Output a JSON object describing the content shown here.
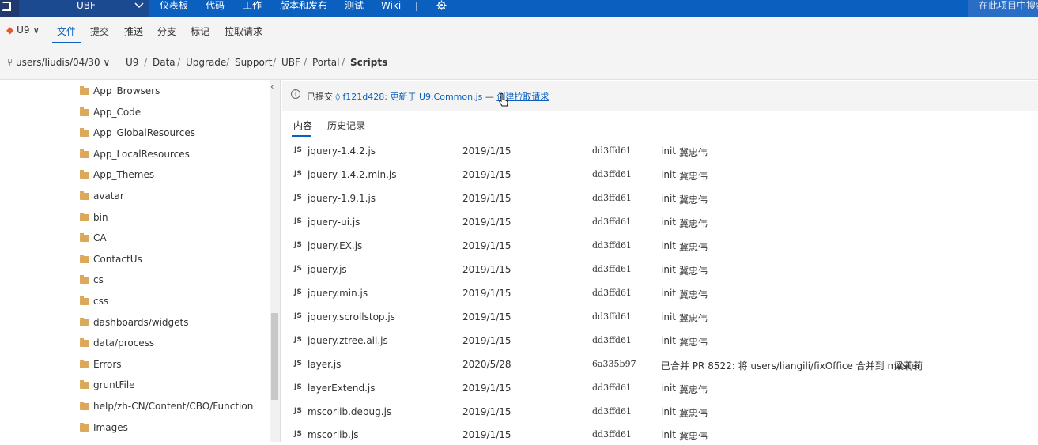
{
  "topbar": {
    "project": "UBF",
    "nav": [
      "仪表板",
      "代码",
      "工作",
      "版本和发布",
      "测试",
      "Wiki"
    ],
    "search_placeholder": "在此项目中搜索"
  },
  "subnav": {
    "repo": "U9",
    "tabs": [
      "文件",
      "提交",
      "推送",
      "分支",
      "标记",
      "拉取请求"
    ],
    "active_tab": "文件"
  },
  "breadcrumb": {
    "branch": "users/liudis/04/30",
    "path": [
      "U9",
      "Data",
      "Upgrade",
      "Support",
      "UBF",
      "Portal",
      "Scripts"
    ]
  },
  "tree": {
    "items": [
      "App_Browsers",
      "App_Code",
      "App_GlobalResources",
      "App_LocalResources",
      "App_Themes",
      "avatar",
      "bin",
      "CA",
      "ContactUs",
      "cs",
      "css",
      "dashboards/widgets",
      "data/process",
      "Errors",
      "gruntFile",
      "help/zh-CN/Content/CBO/Function",
      "Images"
    ]
  },
  "banner": {
    "prefix": "已提交",
    "commit": "f121d428: 更新于 U9.Common.js",
    "dash": "—",
    "link": "创建拉取请求"
  },
  "content_tabs": [
    "内容",
    "历史记录"
  ],
  "files": [
    {
      "icon": "JS",
      "name": "jquery-1.4.2.js",
      "date": "2019/1/15",
      "hash": "dd3ffd61",
      "msg": "init",
      "author": "冀忠伟"
    },
    {
      "icon": "JS",
      "name": "jquery-1.4.2.min.js",
      "date": "2019/1/15",
      "hash": "dd3ffd61",
      "msg": "init",
      "author": "冀忠伟"
    },
    {
      "icon": "JS",
      "name": "jquery-1.9.1.js",
      "date": "2019/1/15",
      "hash": "dd3ffd61",
      "msg": "init",
      "author": "冀忠伟"
    },
    {
      "icon": "JS",
      "name": "jquery-ui.js",
      "date": "2019/1/15",
      "hash": "dd3ffd61",
      "msg": "init",
      "author": "冀忠伟"
    },
    {
      "icon": "JS",
      "name": "jquery.EX.js",
      "date": "2019/1/15",
      "hash": "dd3ffd61",
      "msg": "init",
      "author": "冀忠伟"
    },
    {
      "icon": "JS",
      "name": "jquery.js",
      "date": "2019/1/15",
      "hash": "dd3ffd61",
      "msg": "init",
      "author": "冀忠伟"
    },
    {
      "icon": "JS",
      "name": "jquery.min.js",
      "date": "2019/1/15",
      "hash": "dd3ffd61",
      "msg": "init",
      "author": "冀忠伟"
    },
    {
      "icon": "JS",
      "name": "jquery.scrollstop.js",
      "date": "2019/1/15",
      "hash": "dd3ffd61",
      "msg": "init",
      "author": "冀忠伟"
    },
    {
      "icon": "JS",
      "name": "jquery.ztree.all.js",
      "date": "2019/1/15",
      "hash": "dd3ffd61",
      "msg": "init",
      "author": "冀忠伟"
    },
    {
      "icon": "JS",
      "name": "layer.js",
      "date": "2020/5/28",
      "hash": "6a335b97",
      "msg": "已合并 PR 8522: 将 users/liangili/fixOffice 合并到 master",
      "author": "梁莉莉"
    },
    {
      "icon": "JS",
      "name": "layerExtend.js",
      "date": "2019/1/15",
      "hash": "dd3ffd61",
      "msg": "init",
      "author": "冀忠伟"
    },
    {
      "icon": "JS",
      "name": "mscorlib.debug.js",
      "date": "2019/1/15",
      "hash": "dd3ffd61",
      "msg": "init",
      "author": "冀忠伟"
    },
    {
      "icon": "JS",
      "name": "mscorlib.js",
      "date": "2019/1/15",
      "hash": "dd3ffd61",
      "msg": "init",
      "author": "冀忠伟"
    }
  ],
  "colors": {
    "brand": "#0a5fbf",
    "project_bg": "#1b4a90",
    "repo_icon": "#e05c2b",
    "folder": "#dca85a"
  }
}
